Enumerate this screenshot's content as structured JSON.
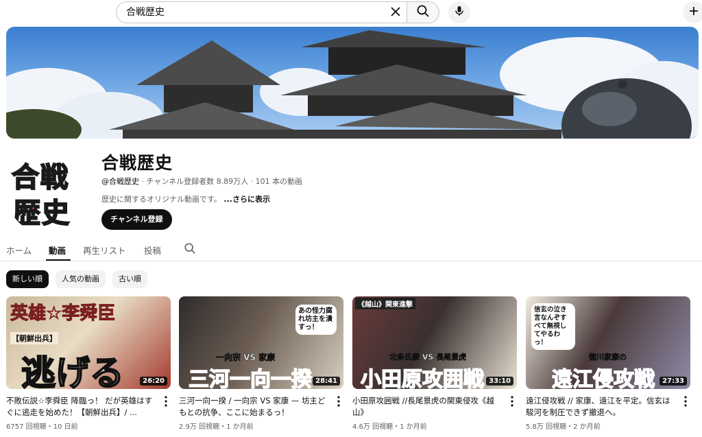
{
  "search": {
    "value": "合戦歴史"
  },
  "icons": {
    "clear": "close-icon",
    "search": "search-icon",
    "mic": "mic-icon",
    "create": "plus-icon",
    "more": "more-vert-icon"
  },
  "channel": {
    "name": "合戦歴史",
    "handle": "@合戦歴史",
    "meta": " · チャンネル登録者数 8.89万人 · 101 本の動画",
    "description": "歴史に関するオリジナル動画です。",
    "more_label": "...さらに表示",
    "subscribe_label": "チャンネル登録",
    "avatar_text_top": "合戦",
    "avatar_text_bottom": "歴史"
  },
  "tabs": [
    {
      "label": "ホーム"
    },
    {
      "label": "動画"
    },
    {
      "label": "再生リスト"
    },
    {
      "label": "投稿"
    }
  ],
  "chips": [
    {
      "label": "新しい順"
    },
    {
      "label": "人気の動画"
    },
    {
      "label": "古い順"
    }
  ],
  "videos": [
    {
      "title": "不敗伝説☆李舜臣 降臨っ！ だが英雄はすぐに逃走を始めた！【朝鮮出兵】/ ...",
      "meta": "6757 回視聴・10 日前",
      "duration": "26:20",
      "thumb_text": "逃げる",
      "thumb_top": "英雄☆李舜臣",
      "thumb_tag": "【朝鮮出兵】",
      "colors": [
        "#b7302a",
        "#e9d9b6"
      ]
    },
    {
      "title": "三河一向一揆 / 一向宗 VS 家康 — 坊主どもとの抗争、ここに始まるっ！",
      "meta": "2.9万 回視聴・1 か月前",
      "duration": "28:41",
      "thumb_text": "三河一向一揆",
      "thumb_top": "一向宗 VS 家康",
      "thumb_tag": "あの怪力腐れ坊主を潰すっ！",
      "colors": [
        "#3d3a3a",
        "#f7f3ea"
      ]
    },
    {
      "title": "小田原攻囲戦 //長尾景虎の関東侵攻《越山》",
      "meta": "4.6万 回視聴・1 か月前",
      "duration": "33:10",
      "thumb_text": "小田原攻囲戦",
      "thumb_top": "北条氏康 VS 長尾景虎",
      "thumb_tag": "《越山》関東進撃",
      "colors": [
        "#5a2f2f",
        "#f5efe3"
      ]
    },
    {
      "title": "遠江侵攻戦 // 家康、遠江を平定。信玄は駿河を制圧できず撤退へ。",
      "meta": "5.8万 回視聴・2 か月前",
      "duration": "27:33",
      "thumb_text": "遠江侵攻戦",
      "thumb_top": "徳川家康の",
      "thumb_tag": "信玄の泣き言なんぞすべて無視してやるわっ！",
      "colors": [
        "#3b2a2a",
        "#f2ede2"
      ]
    }
  ]
}
